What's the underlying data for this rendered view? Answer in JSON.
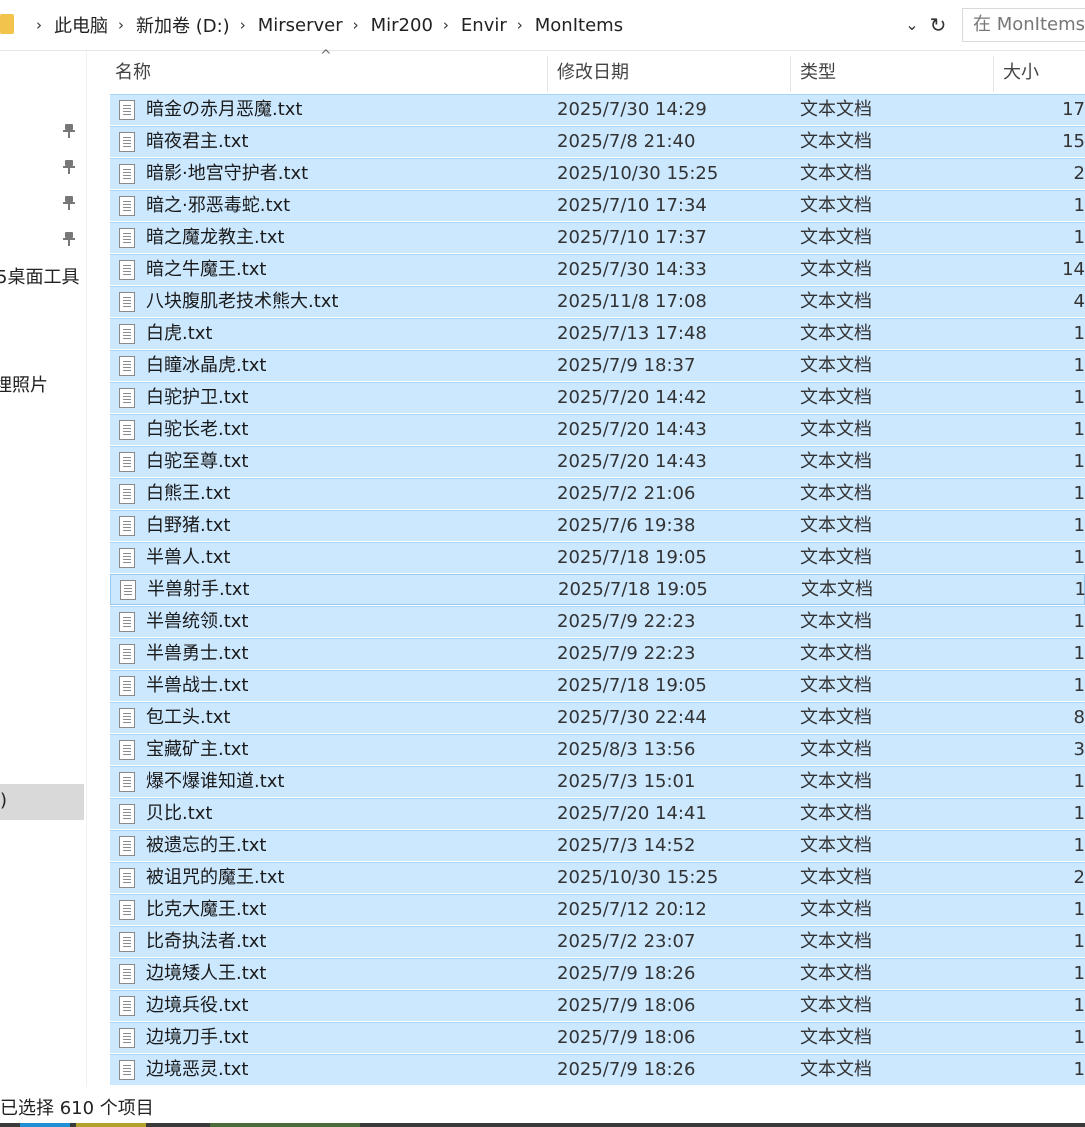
{
  "address_bar": {
    "crumbs": [
      "此电脑",
      "新加卷 (D:)",
      "Mirserver",
      "Mir200",
      "Envir",
      "MonItems"
    ],
    "search_placeholder": "在 MonItems"
  },
  "nav": {
    "items_visible": [
      "5桌面工具",
      "埋照片",
      ")",
      ")"
    ]
  },
  "columns": {
    "name": "名称",
    "date": "修改日期",
    "type": "类型",
    "size": "大小"
  },
  "files": [
    {
      "name": "暗金の赤月恶魔.txt",
      "date": "2025/7/30 14:29",
      "type": "文本文档",
      "size": "17"
    },
    {
      "name": "暗夜君主.txt",
      "date": "2025/7/8 21:40",
      "type": "文本文档",
      "size": "15"
    },
    {
      "name": "暗影·地宫守护者.txt",
      "date": "2025/10/30 15:25",
      "type": "文本文档",
      "size": "2"
    },
    {
      "name": "暗之·邪恶毒蛇.txt",
      "date": "2025/7/10 17:34",
      "type": "文本文档",
      "size": "1"
    },
    {
      "name": "暗之魔龙教主.txt",
      "date": "2025/7/10 17:37",
      "type": "文本文档",
      "size": "1"
    },
    {
      "name": "暗之牛魔王.txt",
      "date": "2025/7/30 14:33",
      "type": "文本文档",
      "size": "14"
    },
    {
      "name": "八块腹肌老技术熊大.txt",
      "date": "2025/11/8 17:08",
      "type": "文本文档",
      "size": "4"
    },
    {
      "name": "白虎.txt",
      "date": "2025/7/13 17:48",
      "type": "文本文档",
      "size": "1"
    },
    {
      "name": "白瞳冰晶虎.txt",
      "date": "2025/7/9 18:37",
      "type": "文本文档",
      "size": "1"
    },
    {
      "name": "白驼护卫.txt",
      "date": "2025/7/20 14:42",
      "type": "文本文档",
      "size": "1"
    },
    {
      "name": "白驼长老.txt",
      "date": "2025/7/20 14:43",
      "type": "文本文档",
      "size": "1"
    },
    {
      "name": "白驼至尊.txt",
      "date": "2025/7/20 14:43",
      "type": "文本文档",
      "size": "1"
    },
    {
      "name": "白熊王.txt",
      "date": "2025/7/2 21:06",
      "type": "文本文档",
      "size": "1"
    },
    {
      "name": "白野猪.txt",
      "date": "2025/7/6 19:38",
      "type": "文本文档",
      "size": "1"
    },
    {
      "name": "半兽人.txt",
      "date": "2025/7/18 19:05",
      "type": "文本文档",
      "size": "1"
    },
    {
      "name": "半兽射手.txt",
      "date": "2025/7/18 19:05",
      "type": "文本文档",
      "size": "1"
    },
    {
      "name": "半兽统领.txt",
      "date": "2025/7/9 22:23",
      "type": "文本文档",
      "size": "1"
    },
    {
      "name": "半兽勇士.txt",
      "date": "2025/7/9 22:23",
      "type": "文本文档",
      "size": "1"
    },
    {
      "name": "半兽战士.txt",
      "date": "2025/7/18 19:05",
      "type": "文本文档",
      "size": "1"
    },
    {
      "name": "包工头.txt",
      "date": "2025/7/30 22:44",
      "type": "文本文档",
      "size": "8"
    },
    {
      "name": "宝藏矿主.txt",
      "date": "2025/8/3 13:56",
      "type": "文本文档",
      "size": "3"
    },
    {
      "name": "爆不爆谁知道.txt",
      "date": "2025/7/3 15:01",
      "type": "文本文档",
      "size": "1"
    },
    {
      "name": "贝比.txt",
      "date": "2025/7/20 14:41",
      "type": "文本文档",
      "size": "1"
    },
    {
      "name": "被遗忘的王.txt",
      "date": "2025/7/3 14:52",
      "type": "文本文档",
      "size": "1"
    },
    {
      "name": "被诅咒的魔王.txt",
      "date": "2025/10/30 15:25",
      "type": "文本文档",
      "size": "2"
    },
    {
      "name": "比克大魔王.txt",
      "date": "2025/7/12 20:12",
      "type": "文本文档",
      "size": "1"
    },
    {
      "name": "比奇执法者.txt",
      "date": "2025/7/2 23:07",
      "type": "文本文档",
      "size": "1"
    },
    {
      "name": "边境矮人王.txt",
      "date": "2025/7/9 18:26",
      "type": "文本文档",
      "size": "1"
    },
    {
      "name": "边境兵役.txt",
      "date": "2025/7/9 18:06",
      "type": "文本文档",
      "size": "1"
    },
    {
      "name": "边境刀手.txt",
      "date": "2025/7/9 18:06",
      "type": "文本文档",
      "size": "1"
    },
    {
      "name": "边境恶灵.txt",
      "date": "2025/7/9 18:26",
      "type": "文本文档",
      "size": "1"
    }
  ],
  "focused_row_index": 15,
  "status": {
    "text": "已选择 610 个项目"
  },
  "colors": {
    "selection": "#cce8ff",
    "selection_border": "#99c9ef",
    "folder": "#f3c44b"
  }
}
